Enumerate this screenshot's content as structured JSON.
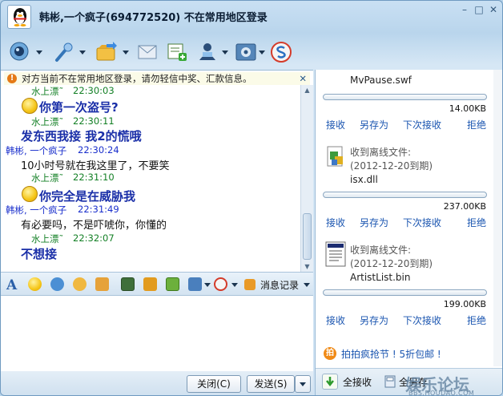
{
  "window": {
    "title": "韩彬,一个疯子(694772520)  不在常用地区登录",
    "controls": {
      "minimize": "–",
      "maximize": "□",
      "close": "✕"
    }
  },
  "toolbar": {
    "items": [
      "video-call",
      "voice-call",
      "send-file",
      "send-mail",
      "create-group",
      "remote-assist",
      "app-settings",
      "sogou"
    ]
  },
  "notice": {
    "text": "对方当前不在常用地区登录，请勿轻信中奖、汇款信息。",
    "close": "✕"
  },
  "messages": {
    "m1": {
      "sender": "水上漂˜",
      "time": "22:30:03",
      "text": "你第一次盗号?"
    },
    "m2": {
      "sender": "水上漂˜",
      "time": "22:30:11",
      "text": "发东西我接  我2的慌哦"
    },
    "m3": {
      "sender": "韩彬, 一个疯子",
      "time": "22:30:24",
      "text": "10小时号就在我这里了，不要笑"
    },
    "m4": {
      "sender": "水上漂˜",
      "time": "22:31:10",
      "text": "你完全是在威胁我"
    },
    "m5": {
      "sender": "韩彬, 一个疯子",
      "time": "22:31:49",
      "text": "有必要吗，不是吓唬你，你懂的"
    },
    "m6": {
      "sender": "水上漂˜",
      "time": "22:32:07",
      "text": "不想接"
    }
  },
  "format_bar": {
    "history_label": "消息记录"
  },
  "buttons": {
    "close": "关闭(C)",
    "send": "发送(S)"
  },
  "files": [
    {
      "name": "MvPause.swf",
      "size": "14.00KB",
      "offline": "",
      "expiry": ""
    },
    {
      "name": "isx.dll",
      "size": "237.00KB",
      "offline": "收到离线文件:",
      "expiry": "(2012-12-20到期)"
    },
    {
      "name": "ArtistList.bin",
      "size": "199.00KB",
      "offline": "收到离线文件:",
      "expiry": "(2012-12-20到期)"
    }
  ],
  "file_actions": {
    "receive": "接收",
    "save_as": "另存为",
    "next_time": "下次接收",
    "reject": "拒绝"
  },
  "promo": {
    "text": "拍拍疯抢节 ! 5折包邮 !"
  },
  "bulk": {
    "accept_all": "全接收",
    "save_all": "全另存"
  },
  "watermark": {
    "main": "娱乐论坛",
    "sub": "BBS.HOUDAO.COM"
  },
  "colors": {
    "accent": "#1a55b0",
    "sender_green": "#148026",
    "sender_blue": "#1a2fcc"
  }
}
